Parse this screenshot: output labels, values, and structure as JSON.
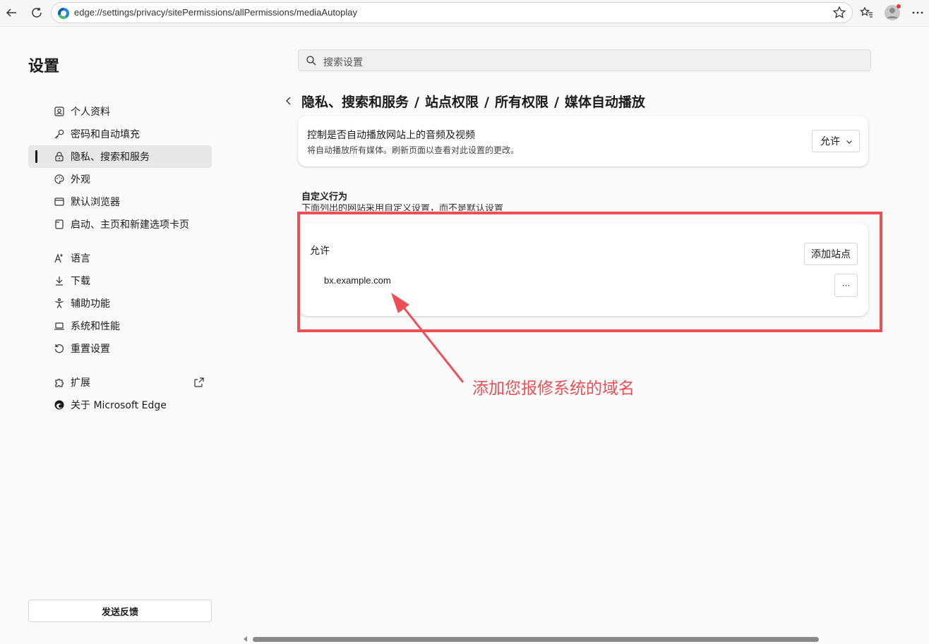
{
  "browser": {
    "url": "edge://settings/privacy/sitePermissions/allPermissions/mediaAutoplay"
  },
  "sidebar": {
    "title": "设置",
    "items": [
      {
        "label": "个人资料",
        "icon": "profile-icon"
      },
      {
        "label": "密码和自动填充",
        "icon": "key-icon"
      },
      {
        "label": "隐私、搜索和服务",
        "icon": "lock-icon",
        "active": true
      },
      {
        "label": "外观",
        "icon": "palette-icon"
      },
      {
        "label": "默认浏览器",
        "icon": "browser-icon"
      },
      {
        "label": "启动、主页和新建选项卡页",
        "icon": "tab-icon"
      },
      {
        "label": "语言",
        "icon": "language-icon"
      },
      {
        "label": "下载",
        "icon": "download-icon"
      },
      {
        "label": "辅助功能",
        "icon": "accessibility-icon"
      },
      {
        "label": "系统和性能",
        "icon": "laptop-icon"
      },
      {
        "label": "重置设置",
        "icon": "reset-icon"
      },
      {
        "label": "扩展",
        "icon": "puzzle-icon"
      },
      {
        "label": "关于 Microsoft Edge",
        "icon": "edge-icon"
      }
    ],
    "feedback_label": "发送反馈"
  },
  "search": {
    "placeholder": "搜索设置"
  },
  "breadcrumb": [
    "隐私、搜索和服务",
    "站点权限",
    "所有权限",
    "媒体自动播放"
  ],
  "autoplay_card": {
    "title": "控制是否自动播放网站上的音频及视频",
    "description": "将自动播放所有媒体。刷新页面以查看对此设置的更改。",
    "selected": "允许"
  },
  "custom": {
    "title": "自定义行为",
    "description": "下面列出的网站采用自定义设置，而不是默认设置"
  },
  "allow_list": {
    "title": "允许",
    "add_label": "添加站点",
    "sites": [
      "bx.example.com"
    ],
    "more_label": "···"
  },
  "annotation": {
    "text": "添加您报修系统的域名",
    "color": "#ee4f56"
  }
}
